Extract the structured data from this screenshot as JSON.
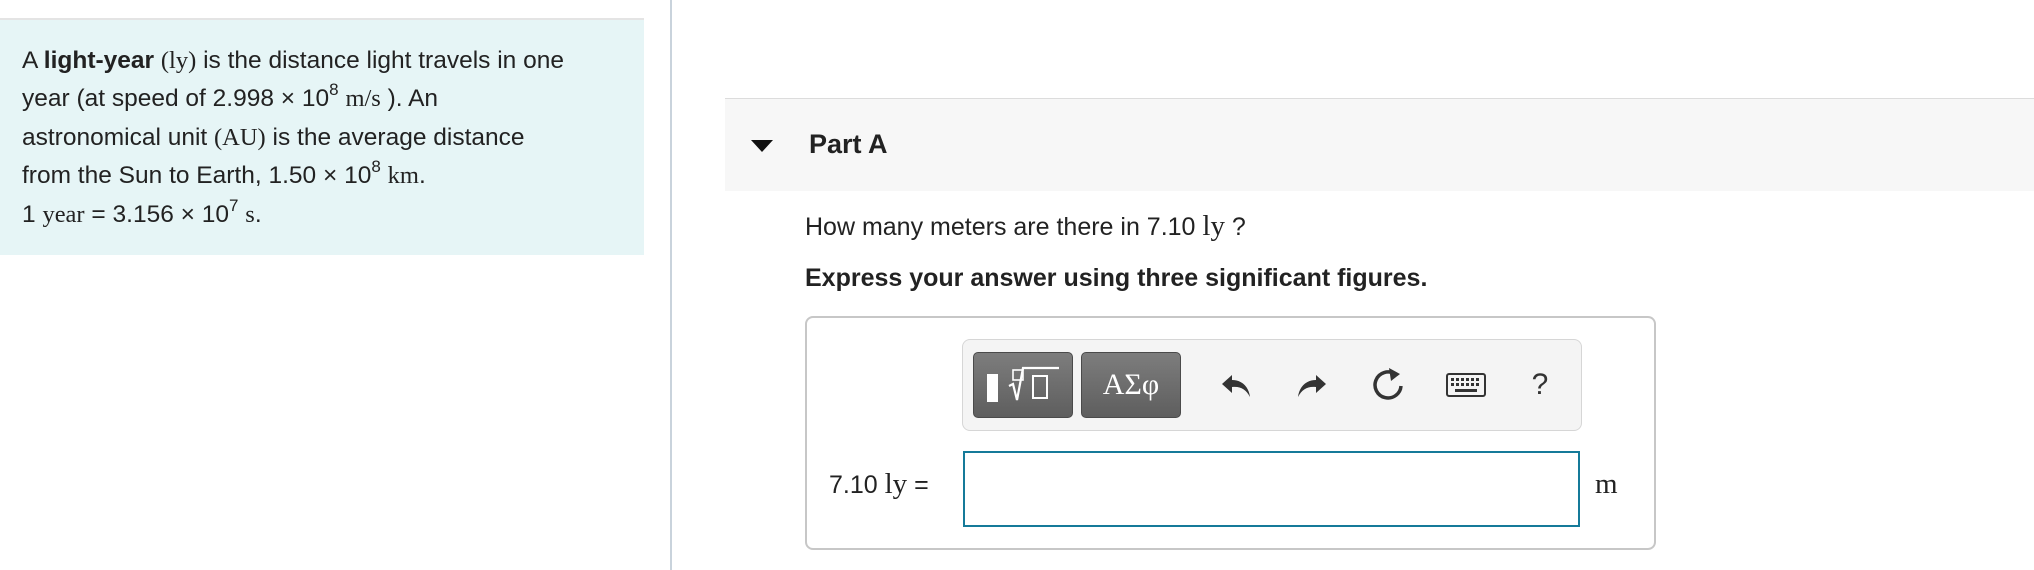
{
  "info": {
    "intro": "A ",
    "term": "light-year",
    "abbr_ly": "(ly)",
    "line1_rest": " is the distance light travels in one",
    "line2_pre": "year (at speed of 2.998 × 10",
    "exp_8": "8",
    "speed_unit": "m/s",
    "line2_post": " ). An",
    "line3_pre": "astronomical unit ",
    "abbr_au": "(AU)",
    "line3_post": " is the average distance",
    "line4_pre": "from the Sun to Earth, 1.50 × 10",
    "exp_8b": "8",
    "km_unit": "km",
    "line4_post": ".",
    "line5_pre": "1 ",
    "year_word": "year",
    "line5_mid": " = 3.156 × 10",
    "exp_7": "7",
    "sec_unit": "s",
    "line5_post": "."
  },
  "part": {
    "title": "Part A"
  },
  "question": {
    "pre": "How many meters are there in 7.10 ",
    "unit": "ly",
    "post": " ?"
  },
  "instruction": "Express your answer using three significant figures.",
  "toolbar": {
    "symbols_label": "ΑΣφ",
    "help_label": "?"
  },
  "answer": {
    "prefix_number": "7.10 ",
    "prefix_unit": "ly",
    "equals": " =",
    "value": "",
    "placeholder": "",
    "unit": "m"
  },
  "colors": {
    "info_bg": "#e6f5f6",
    "input_border": "#157a99",
    "button_gray": "#6b6b6b"
  }
}
